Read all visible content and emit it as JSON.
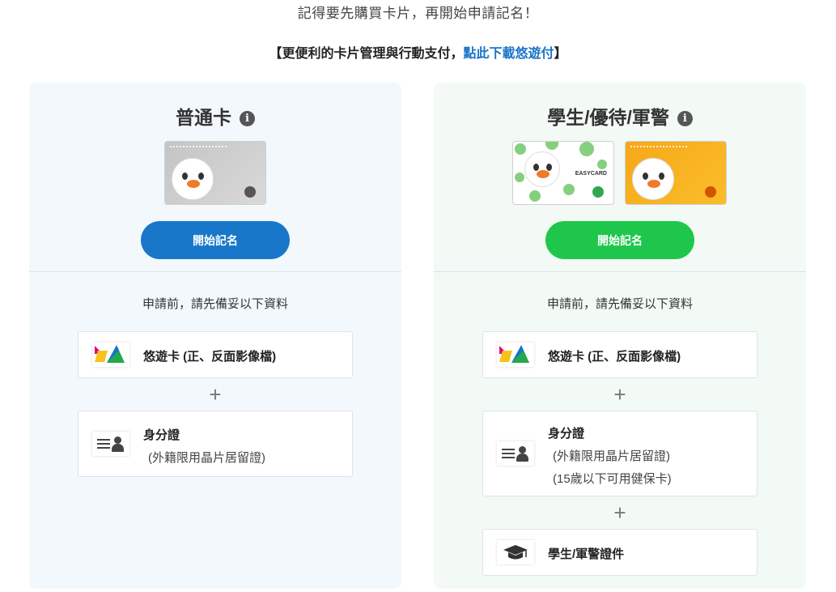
{
  "top_note": "記得要先購買卡片，再開始申請記名！",
  "promo": {
    "prefix": "【更便利的卡片管理與行動支付，",
    "link": "點此下載悠遊付",
    "suffix": "】"
  },
  "left_panel": {
    "title": "普通卡",
    "info_icon": "info-icon",
    "button_label": "開始記名",
    "button_color": "#1877c9",
    "prep_label": "申請前，請先備妥以下資料",
    "docs": [
      {
        "icon": "easycard-logo-icon",
        "title": "悠遊卡 (正、反面影像檔)"
      },
      {
        "icon": "id-card-icon",
        "title": "身分證",
        "sub1": "(外籍限用晶片居留證)"
      }
    ],
    "plus": "+"
  },
  "right_panel": {
    "title": "學生/優待/軍警",
    "info_icon": "info-icon",
    "button_label": "開始記名",
    "button_color": "#1ec74b",
    "prep_label": "申請前，請先備妥以下資料",
    "docs": [
      {
        "icon": "easycard-logo-icon",
        "title": "悠遊卡 (正、反面影像檔)"
      },
      {
        "icon": "id-card-icon",
        "title": "身分證",
        "sub1": "(外籍限用晶片居留證)",
        "sub2": "(15歲以下可用健保卡)"
      },
      {
        "icon": "graduation-cap-icon",
        "title": "學生/軍警證件"
      }
    ],
    "plus": "+",
    "card_white_brand": "EASYCARD"
  }
}
